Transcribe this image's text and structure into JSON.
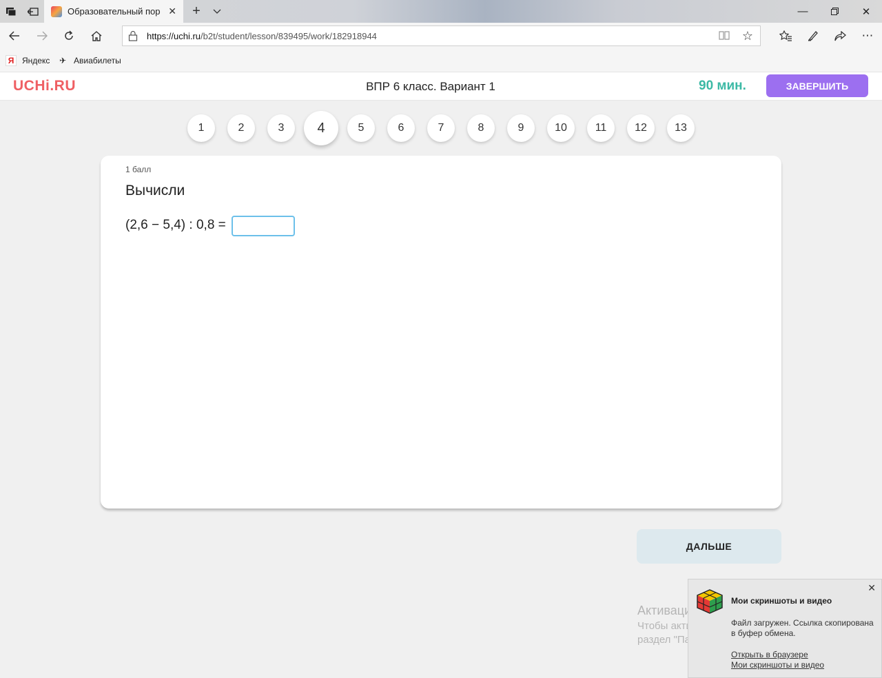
{
  "browser": {
    "tab_title": "Образовательный пор",
    "url_host": "https://uchi.ru",
    "url_path": "/b2t/student/lesson/839495/work/182918944",
    "favorites": [
      {
        "label": "Яндекс",
        "icon": "yandex-icon"
      },
      {
        "label": "Авиабилеты",
        "icon": "airplane-icon"
      }
    ]
  },
  "header": {
    "logo": "UCHi.RU",
    "title": "ВПР 6 класс. Вариант 1",
    "timer": "90 мин.",
    "finish_label": "ЗАВЕРШИТЬ"
  },
  "question_nav": {
    "items": [
      "1",
      "2",
      "3",
      "4",
      "5",
      "6",
      "7",
      "8",
      "9",
      "10",
      "11",
      "12",
      "13"
    ],
    "active": "4"
  },
  "question": {
    "points": "1 балл",
    "title": "Вычисли",
    "expression": "(2,6 − 5,4) : 0,8 =",
    "answer_value": ""
  },
  "next_label": "ДАЛЬШЕ",
  "watermark": {
    "line1": "Активация Windows",
    "line2": "Чтобы активировать Windows, перейдите в",
    "line3": "раздел \"Параметры\"."
  },
  "notification": {
    "title": "Мои скриншоты и видео",
    "text": "Файл загружен. Ссылка скопирована в буфер обмена.",
    "link1": "Открыть в браузере",
    "link2": "Мои скриншоты и видео"
  },
  "colors": {
    "logo": "#ef5f63",
    "timer": "#3cb9a5",
    "finish_button": "#9c6ff0",
    "next_button": "#dde9ee",
    "answer_border": "#6cc0ea"
  }
}
